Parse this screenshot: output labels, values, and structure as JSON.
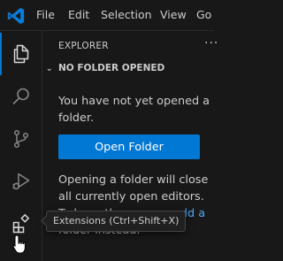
{
  "titlebar": {
    "logo_icon": "vscode-logo",
    "menu": [
      "File",
      "Edit",
      "Selection",
      "View",
      "Go"
    ]
  },
  "activitybar": {
    "items": [
      {
        "icon": "files-icon",
        "active": true
      },
      {
        "icon": "search-icon",
        "active": false
      },
      {
        "icon": "source-control-icon",
        "active": false
      },
      {
        "icon": "run-debug-icon",
        "active": false
      },
      {
        "icon": "extensions-icon",
        "active": false
      }
    ]
  },
  "sidebar": {
    "title": "EXPLORER",
    "more_actions": "···",
    "section": {
      "title": "NO FOLDER OPENED",
      "message": "You have not yet opened a folder.",
      "button": "Open Folder",
      "note_line1": "Opening a folder will close all currently open editors.",
      "note_line2_visible": "To keep them open,",
      "note_link_visible": "add a",
      "note_line3_visible": "folder instead."
    }
  },
  "tooltip": {
    "text": "Extensions (Ctrl+Shift+X)"
  },
  "colors": {
    "accent": "#0078d4",
    "link": "#4daafc",
    "background": "#181818"
  }
}
